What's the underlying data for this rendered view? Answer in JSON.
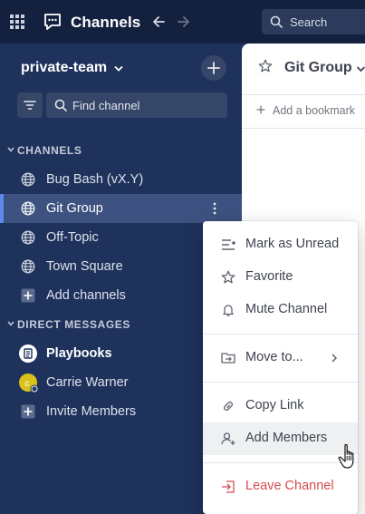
{
  "topbar": {
    "title": "Channels",
    "search_placeholder": "Search",
    "icons": [
      "product-grid-icon",
      "channels-icon",
      "back-arrow-icon",
      "forward-arrow-icon",
      "search-icon"
    ]
  },
  "sidebar": {
    "team_name": "private-team",
    "find_placeholder": "Find channel",
    "channels_header": "CHANNELS",
    "channels": [
      {
        "label": "Bug Bash (vX.Y)",
        "icon": "globe-icon"
      },
      {
        "label": "Git Group",
        "icon": "globe-icon",
        "active": true
      },
      {
        "label": "Off-Topic",
        "icon": "globe-icon"
      },
      {
        "label": "Town Square",
        "icon": "globe-icon"
      },
      {
        "label": "Add channels",
        "icon": "plus-box-icon"
      }
    ],
    "dm_header": "DIRECT MESSAGES",
    "dms": [
      {
        "label": "Playbooks",
        "icon": "playbooks-icon",
        "bold": true
      },
      {
        "label": "Carrie Warner",
        "icon": "avatar-icon"
      },
      {
        "label": "Invite Members",
        "icon": "plus-box-icon"
      }
    ]
  },
  "main": {
    "channel_title": "Git Group",
    "bookmark_label": "Add a bookmark"
  },
  "menu": {
    "items": [
      {
        "label": "Mark as Unread",
        "icon": "mark-unread-icon"
      },
      {
        "label": "Favorite",
        "icon": "star-icon"
      },
      {
        "label": "Mute Channel",
        "icon": "bell-icon"
      },
      {
        "label": "Move to...",
        "icon": "move-folder-icon"
      },
      {
        "label": "Copy Link",
        "icon": "link-icon"
      },
      {
        "label": "Add Members",
        "icon": "add-member-icon"
      },
      {
        "label": "Leave Channel",
        "icon": "leave-icon"
      }
    ]
  },
  "colors": {
    "sidebar_bg": "#1e325c",
    "topbar_bg": "#14213e",
    "active_item_bg": "#3d5280",
    "active_bar": "#5d89ea",
    "danger": "#d24b4e"
  }
}
